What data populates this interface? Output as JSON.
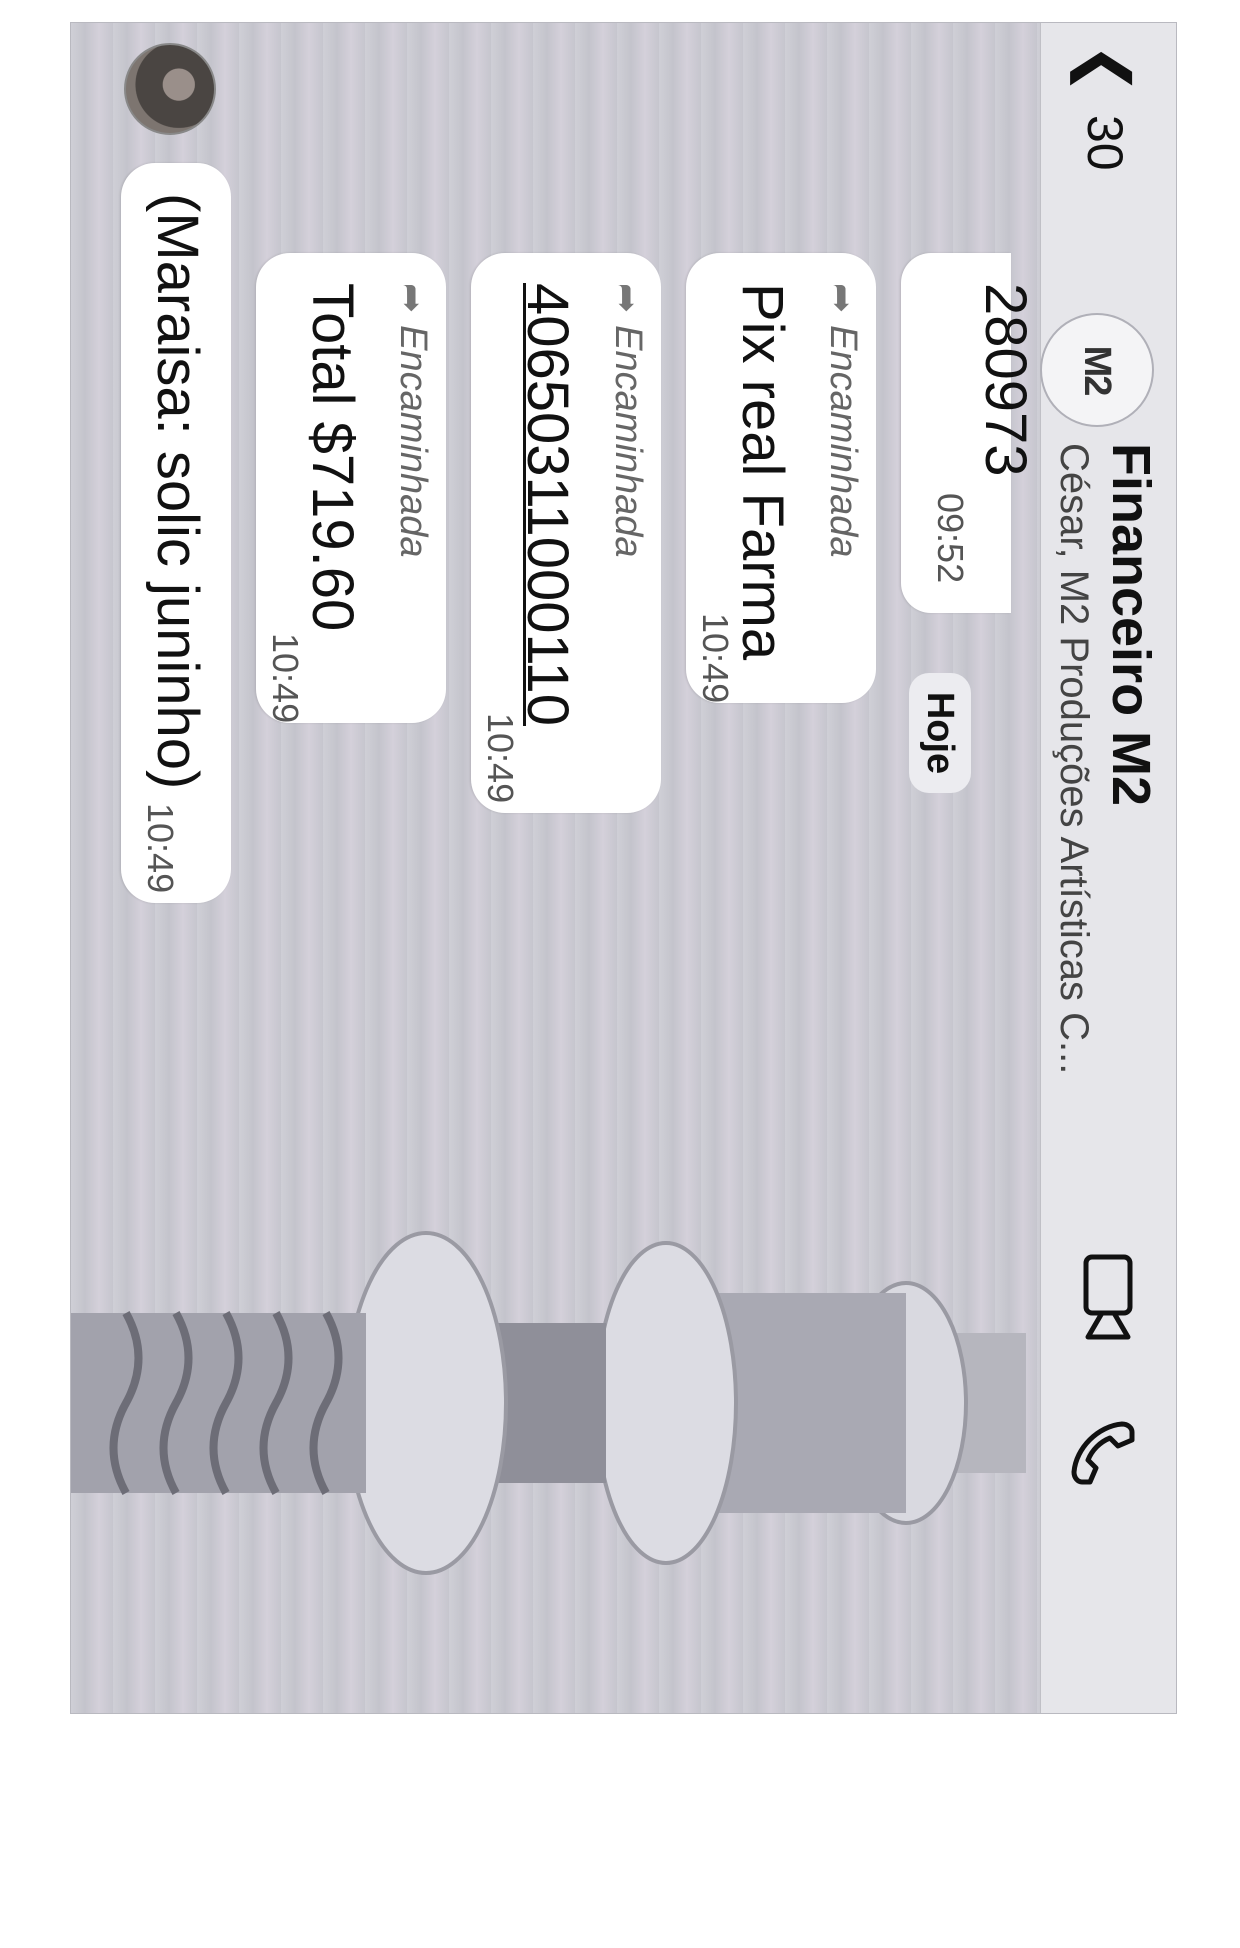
{
  "header": {
    "back_count": "30",
    "group_title": "Financeiro M2",
    "group_members": "César, M2 Produções Artísticas C...",
    "group_avatar": "M2",
    "icons": [
      "chevron-left-icon",
      "video-call-icon",
      "phone-call-icon"
    ]
  },
  "date_separator": "Hoje",
  "messages": [
    {
      "text": "280973",
      "time": "09:52",
      "forwarded": false
    },
    {
      "forward_label": "Encaminhada",
      "text": "Pix real Farma",
      "time": "10:49",
      "forwarded": true
    },
    {
      "forward_label": "Encaminhada",
      "text": "40650311000110",
      "time": "10:49",
      "forwarded": true,
      "link": true
    },
    {
      "forward_label": "Encaminhada",
      "text": "Total $719.60",
      "time": "10:49",
      "forwarded": true
    },
    {
      "text": "(Maraisa: solic juninho)",
      "time": "10:49",
      "forwarded": false
    }
  ]
}
